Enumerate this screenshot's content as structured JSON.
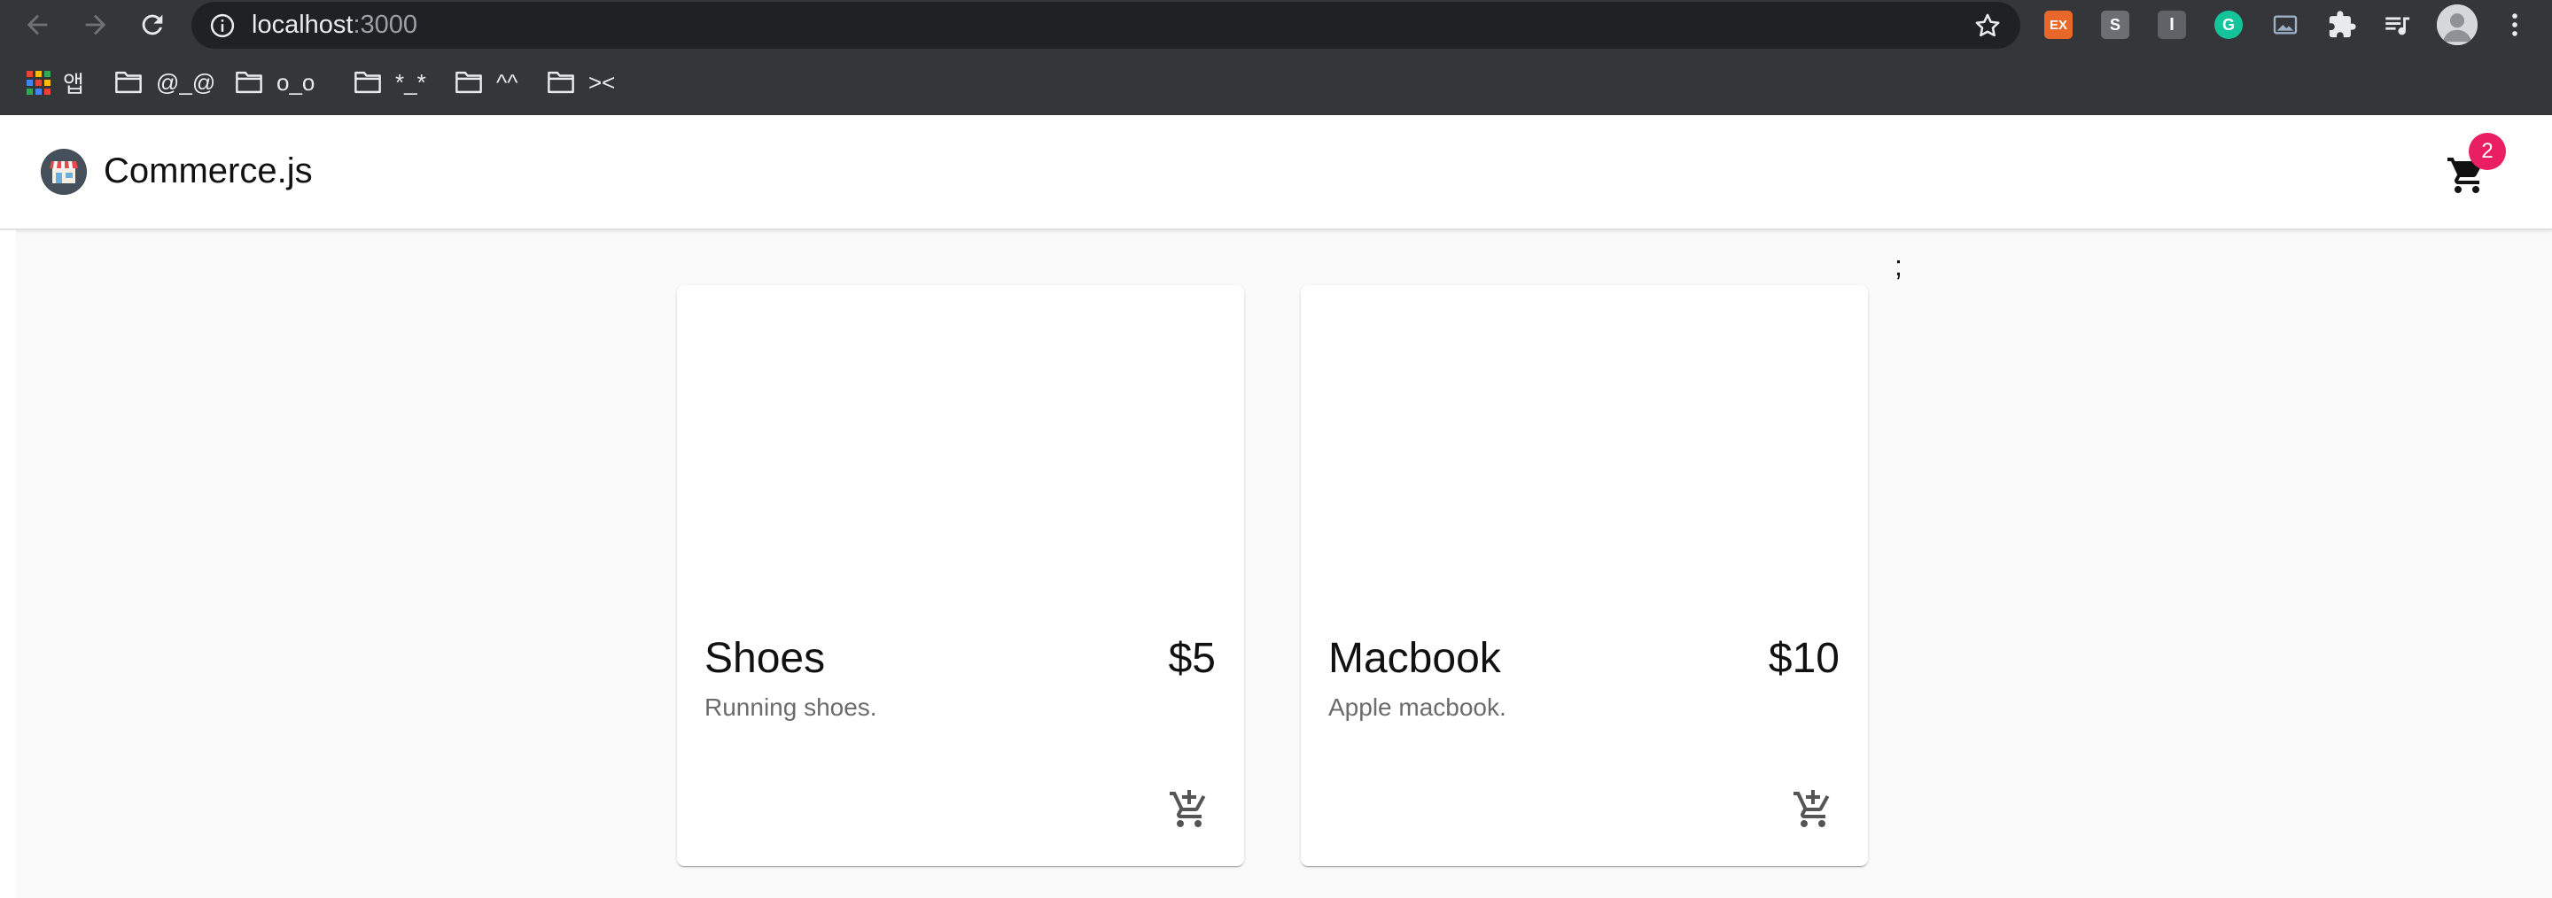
{
  "browser": {
    "url_host": "localhost",
    "url_port": ":3000",
    "extensions": {
      "ex_label": "EX",
      "s_label": "S",
      "i_label": "I",
      "g_label": "G"
    },
    "bookmarks": [
      {
        "label": "앱",
        "icon": "apps-grid-icon"
      },
      {
        "label": "@_@",
        "icon": "folder-icon"
      },
      {
        "label": "o_o",
        "icon": "folder-icon"
      },
      {
        "label": "*_*",
        "icon": "folder-icon"
      },
      {
        "label": "^^",
        "icon": "folder-icon"
      },
      {
        "label": "><",
        "icon": "folder-icon"
      }
    ]
  },
  "app": {
    "brand": "Commerce.js",
    "cart_count": "2",
    "stray_text": ";",
    "products": [
      {
        "name": "Shoes",
        "price": "$5",
        "description": "Running shoes."
      },
      {
        "name": "Macbook",
        "price": "$10",
        "description": "Apple macbook."
      }
    ]
  },
  "colors": {
    "badge": "#e91e63",
    "toolbar": "#35363a",
    "omnibox": "#202124",
    "page_bg": "#fafafa"
  }
}
